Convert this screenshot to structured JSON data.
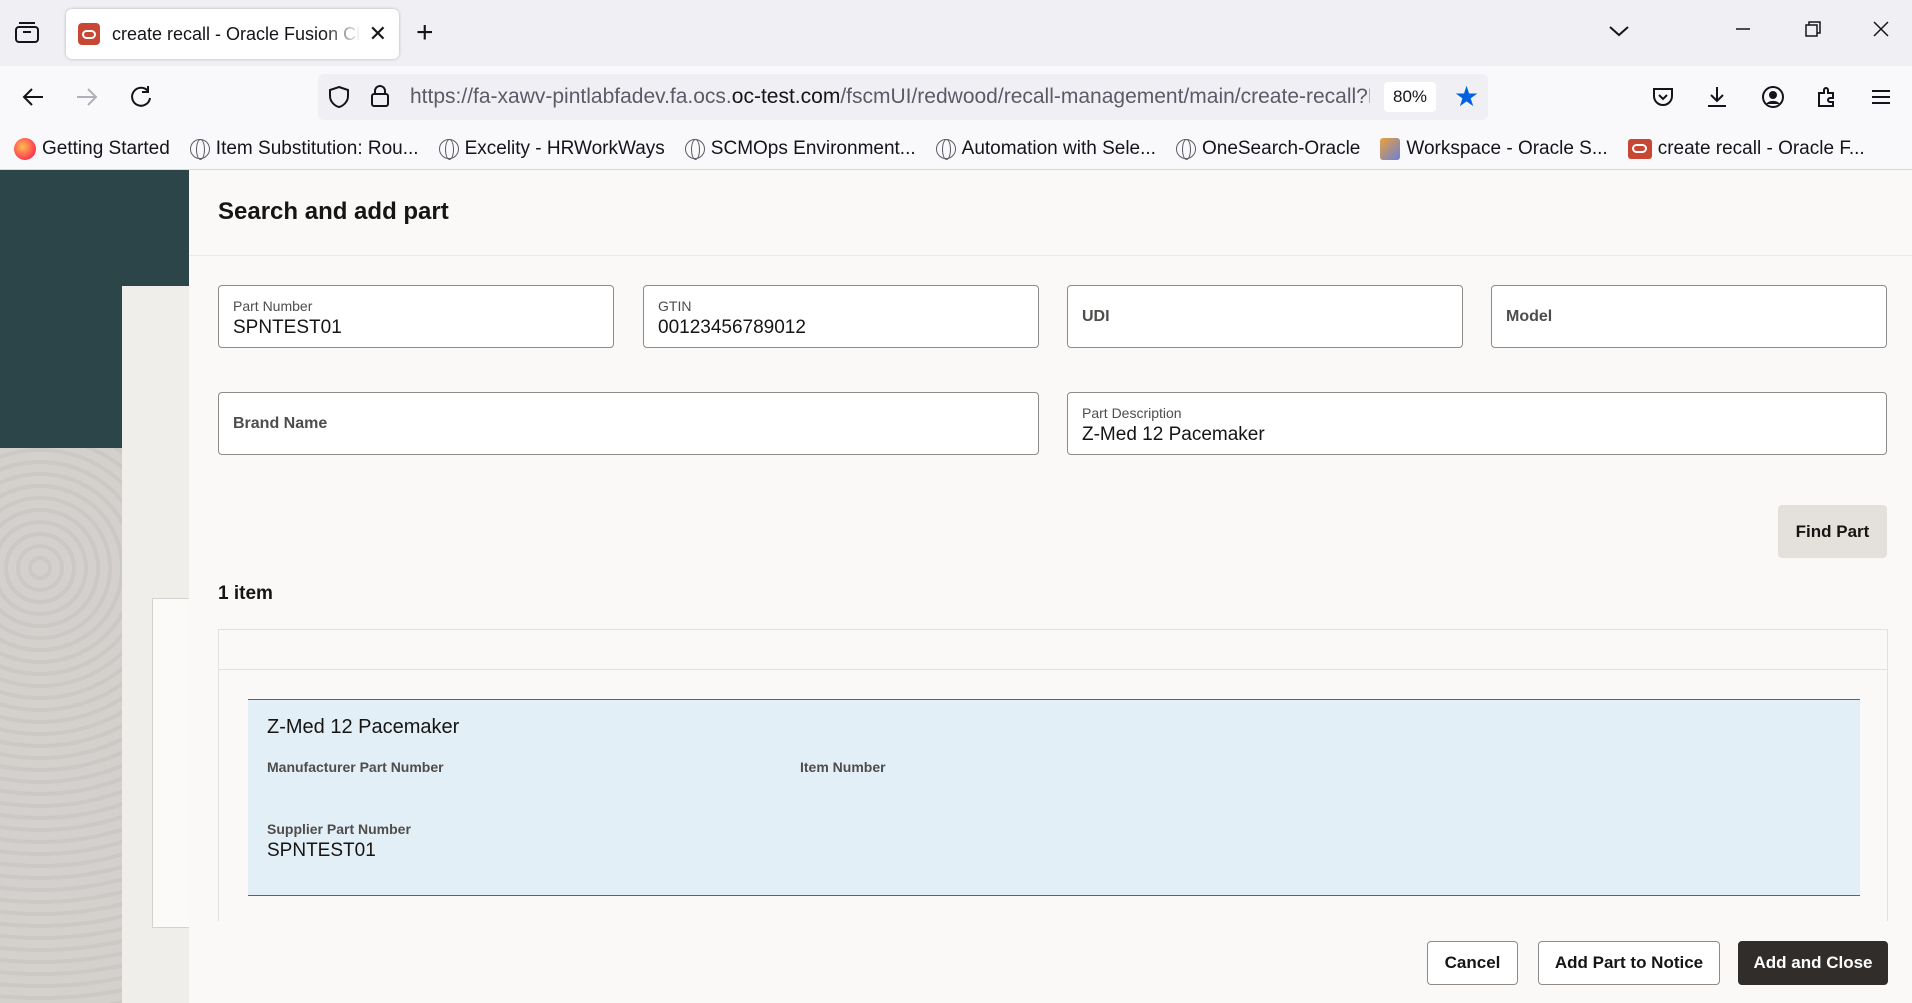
{
  "browser": {
    "tab_title": "create recall - Oracle Fusion Cloud",
    "url_prefix": "https://fa-xawv-pintlabfadev.fa.ocs.",
    "url_domain": "oc-test.com",
    "url_path": "/fscmUI/redwood/recall-management/main/create-recall?E",
    "zoom": "80%",
    "bookmarks": [
      "Getting Started",
      "Item Substitution: Rou...",
      "Excelity - HRWorkWays",
      "SCMOps Environment...",
      "Automation with Sele...",
      "OneSearch-Oracle",
      "Workspace - Oracle S...",
      "create recall - Oracle F..."
    ]
  },
  "drawer": {
    "title": "Search and add part",
    "fields": {
      "part_number": {
        "label": "Part Number",
        "value": "SPNTEST01"
      },
      "gtin": {
        "label": "GTIN",
        "value": "00123456789012"
      },
      "udi": {
        "label": "UDI",
        "value": ""
      },
      "model": {
        "label": "Model",
        "value": ""
      },
      "brand_name": {
        "label": "Brand Name",
        "value": ""
      },
      "part_description": {
        "label": "Part Description",
        "value": "Z-Med 12 Pacemaker"
      }
    },
    "find_button": "Find Part",
    "result_count": "1 item",
    "results": [
      {
        "name": "Z-Med 12 Pacemaker",
        "manufacturer_part_number_label": "Manufacturer Part Number",
        "manufacturer_part_number": "",
        "item_number_label": "Item Number",
        "item_number": "",
        "supplier_part_number_label": "Supplier Part Number",
        "supplier_part_number": "SPNTEST01"
      }
    ],
    "footer": {
      "cancel": "Cancel",
      "add_part": "Add Part to Notice",
      "add_close": "Add and Close"
    }
  }
}
